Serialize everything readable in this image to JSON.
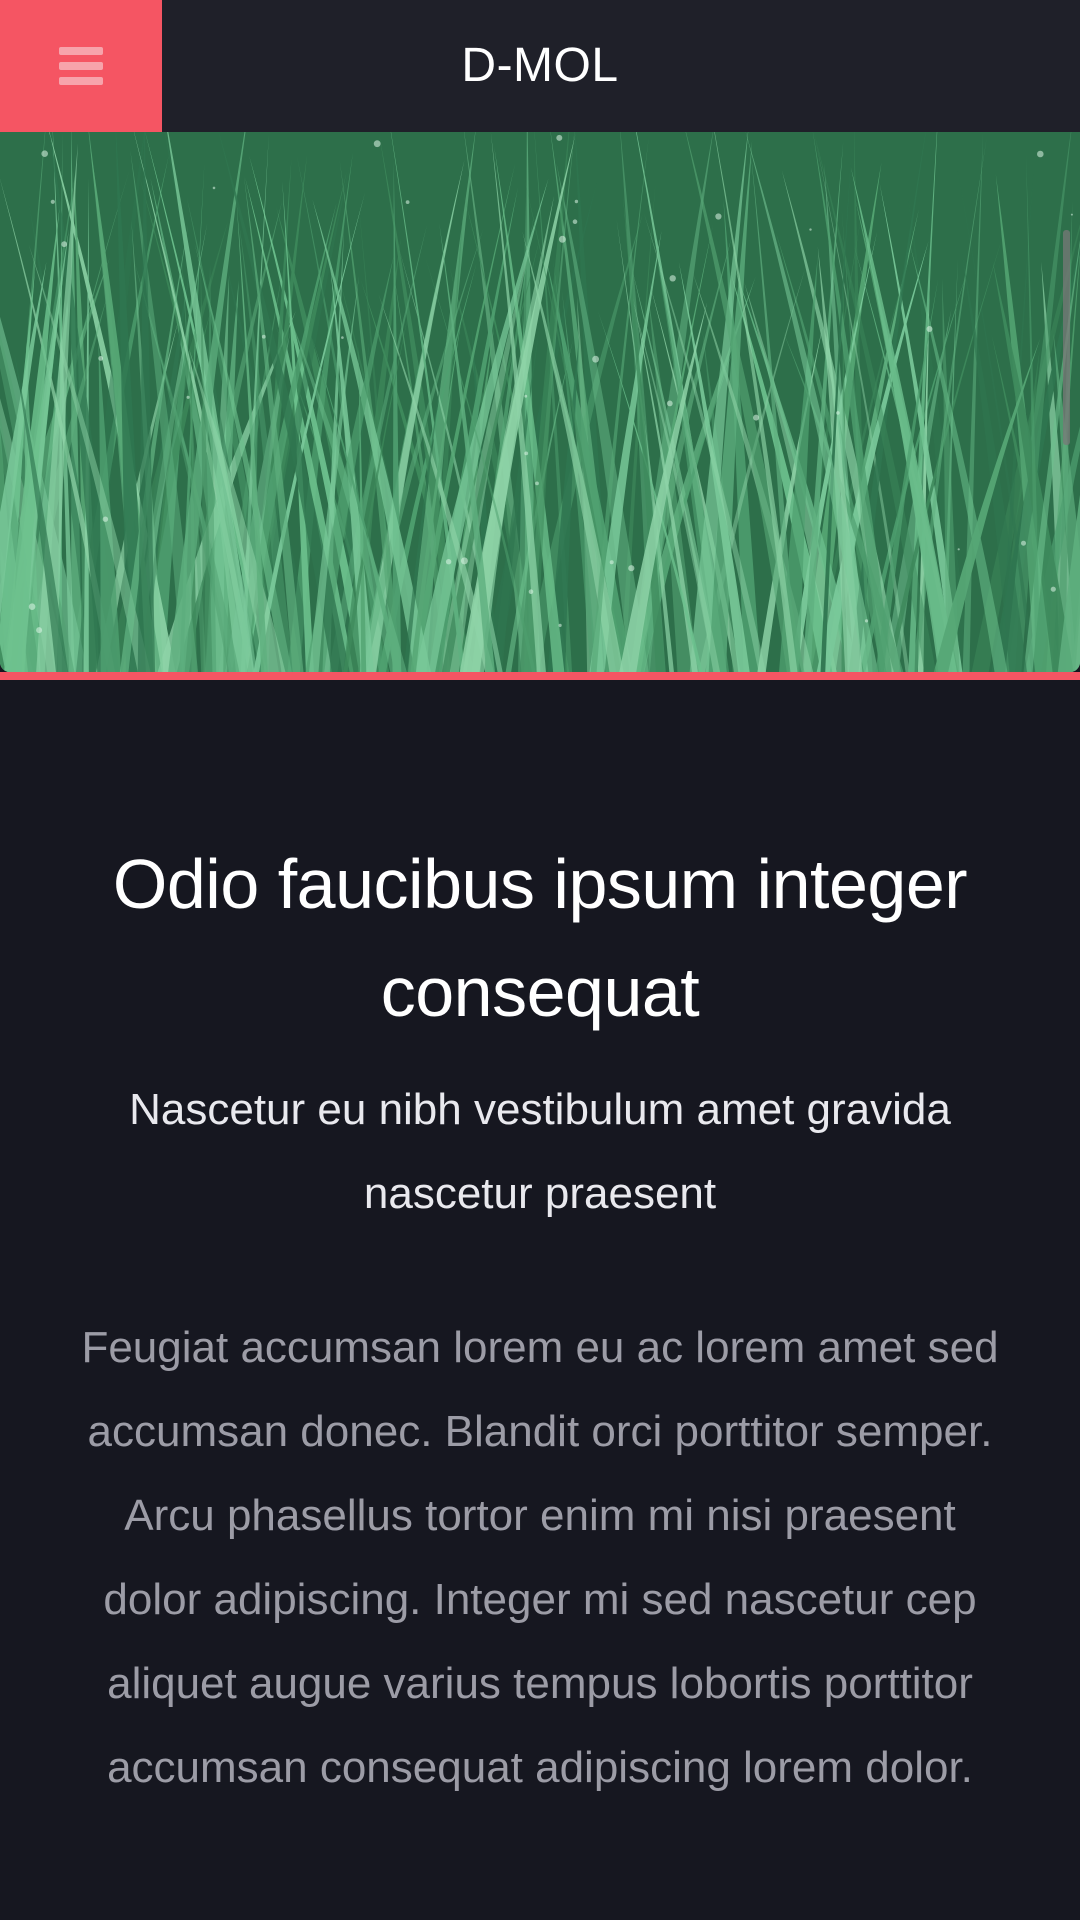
{
  "header": {
    "title": "D-MOL",
    "menu_icon": "hamburger-menu-icon"
  },
  "hero": {
    "image": "grass-photo"
  },
  "colors": {
    "accent": "#f55563",
    "header_bg": "#1f2029",
    "page_bg": "#161720"
  },
  "content": {
    "headline": "Odio faucibus ipsum integer consequat",
    "subheadline": "Nascetur eu nibh vestibulum amet gravida nascetur praesent",
    "body": "Feugiat accumsan lorem eu ac lorem amet sed accumsan donec. Blandit orci porttitor semper. Arcu phasellus tortor enim mi nisi praesent dolor adipiscing. Integer mi sed nascetur cep aliquet augue varius tempus lobortis porttitor accumsan consequat adipiscing lorem dolor."
  }
}
